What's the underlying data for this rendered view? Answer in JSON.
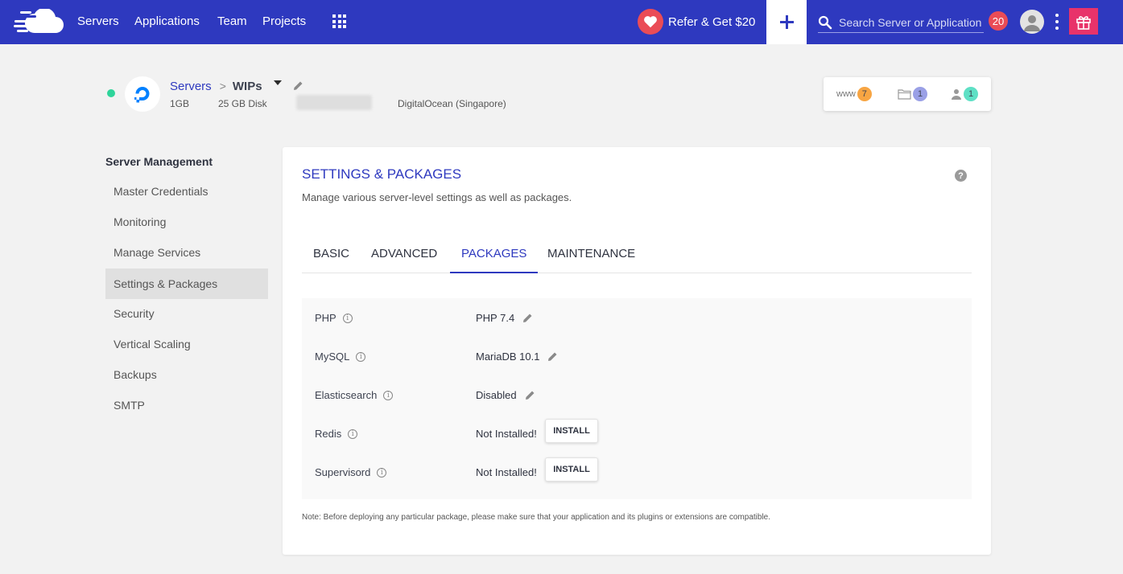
{
  "topbar": {
    "nav": [
      "Servers",
      "Applications",
      "Team",
      "Projects"
    ],
    "refer_label": "Refer & Get $20",
    "search_placeholder": "Search Server or Application",
    "notification_count": "20"
  },
  "server": {
    "breadcrumb_parent": "Servers",
    "breadcrumb_separator": ">",
    "name": "WIPs",
    "ram": "1GB",
    "disk": "25 GB Disk",
    "provider": "DigitalOcean (Singapore)",
    "stats": {
      "www_label": "www",
      "apps_count": "7",
      "files_count": "1",
      "users_count": "1"
    }
  },
  "sidebar": {
    "title": "Server Management",
    "items": [
      {
        "label": "Master Credentials",
        "active": false
      },
      {
        "label": "Monitoring",
        "active": false
      },
      {
        "label": "Manage Services",
        "active": false
      },
      {
        "label": "Settings & Packages",
        "active": true
      },
      {
        "label": "Security",
        "active": false
      },
      {
        "label": "Vertical Scaling",
        "active": false
      },
      {
        "label": "Backups",
        "active": false
      },
      {
        "label": "SMTP",
        "active": false
      }
    ]
  },
  "main": {
    "title": "SETTINGS & PACKAGES",
    "subtitle": "Manage various server-level settings as well as packages.",
    "help_glyph": "?",
    "tabs": [
      {
        "label": "BASIC",
        "active": false
      },
      {
        "label": "ADVANCED",
        "active": false
      },
      {
        "label": "PACKAGES",
        "active": true
      },
      {
        "label": "MAINTENANCE",
        "active": false
      }
    ],
    "packages": [
      {
        "name": "PHP",
        "value": "PHP 7.4",
        "editable": true
      },
      {
        "name": "MySQL",
        "value": "MariaDB 10.1",
        "editable": true
      },
      {
        "name": "Elasticsearch",
        "value": "Disabled",
        "editable": true
      },
      {
        "name": "Redis",
        "value": "Not Installed!",
        "action": "INSTALL"
      },
      {
        "name": "Supervisord",
        "value": "Not Installed!",
        "action": "INSTALL"
      }
    ],
    "note": "Note: Before deploying any particular package, please make sure that your application and its plugins or extensions are compatible."
  },
  "colors": {
    "brand": "#2e39bf",
    "notification": "#ea4c56",
    "gift": "#e8336a",
    "online": "#2ed49a",
    "apps_badge": "#f7a543",
    "files_badge": "#9aa0e6",
    "users_badge": "#5ee0c5"
  },
  "icons": {
    "logo": "cloudways-logo-icon",
    "apps_grid": "grid-icon",
    "refer": "heart-icon",
    "add": "plus-icon",
    "search": "search-icon",
    "profile": "avatar-icon",
    "menu": "kebab-menu-icon",
    "gift": "gift-icon",
    "provider": "digitalocean-logo-icon",
    "edit": "pencil-icon",
    "info": "info-icon",
    "help": "help-icon",
    "files": "folder-icon",
    "users": "user-icon"
  }
}
